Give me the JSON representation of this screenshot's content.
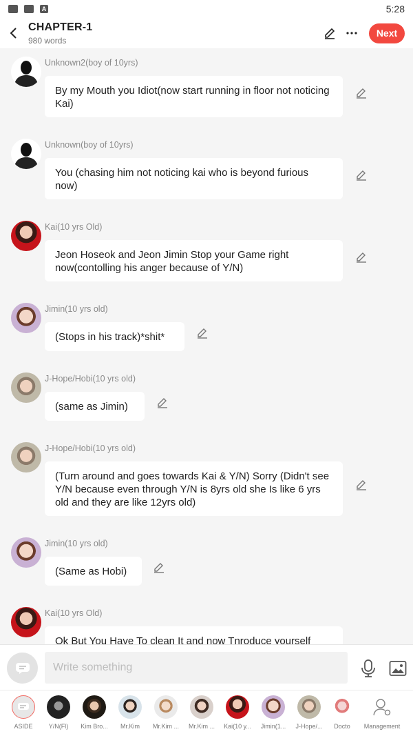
{
  "status_bar": {
    "time": "5:28"
  },
  "header": {
    "title": "CHAPTER-1",
    "subtitle": "980 words",
    "next_label": "Next"
  },
  "messages": [
    {
      "name": "Unknown2(boy of 10yrs)",
      "text": "By my Mouth you Idiot(now start running in floor not noticing Kai)",
      "avatar": "silhouette"
    },
    {
      "name": "Unknown(boy of 10yrs)",
      "text": "You (chasing him not noticing kai who is beyond furious now)",
      "avatar": "silhouette"
    },
    {
      "name": "Kai(10 yrs Old)",
      "text": "Jeon Hoseok and Jeon Jimin Stop your Game right now(contolling his anger because of Y/N)",
      "avatar": "kai"
    },
    {
      "name": "Jimin(10 yrs old)",
      "text": "(Stops in his track)*shit*",
      "avatar": "jimin"
    },
    {
      "name": "J-Hope/Hobi(10 yrs old)",
      "text": "(same as Jimin)",
      "avatar": "hobi"
    },
    {
      "name": "J-Hope/Hobi(10 yrs old)",
      "text": "(Turn around and goes towards Kai & Y/N) Sorry (Didn't see Y/N because even through Y/N is 8yrs old she Is like 6 yrs old and they are like 12yrs old)",
      "avatar": "hobi"
    },
    {
      "name": "Jimin(10 yrs old)",
      "text": "(Same as Hobi)",
      "avatar": "jimin"
    },
    {
      "name": "Kai(10 yrs Old)",
      "text": "Ok But You Have To clean It and now Tnroduce yourself",
      "avatar": "kai"
    }
  ],
  "composer": {
    "placeholder": "Write something"
  },
  "characters": [
    {
      "label": "ASIDE"
    },
    {
      "label": "Y/N(Fl)"
    },
    {
      "label": "Kim Bro..."
    },
    {
      "label": "Mr.Kim"
    },
    {
      "label": "Mr.Kim ..."
    },
    {
      "label": "Mr.Kim ..."
    },
    {
      "label": "Kai(10 y..."
    },
    {
      "label": "Jimin(1..."
    },
    {
      "label": "J-Hope/..."
    },
    {
      "label": "Docto"
    },
    {
      "label": "Management"
    }
  ]
}
